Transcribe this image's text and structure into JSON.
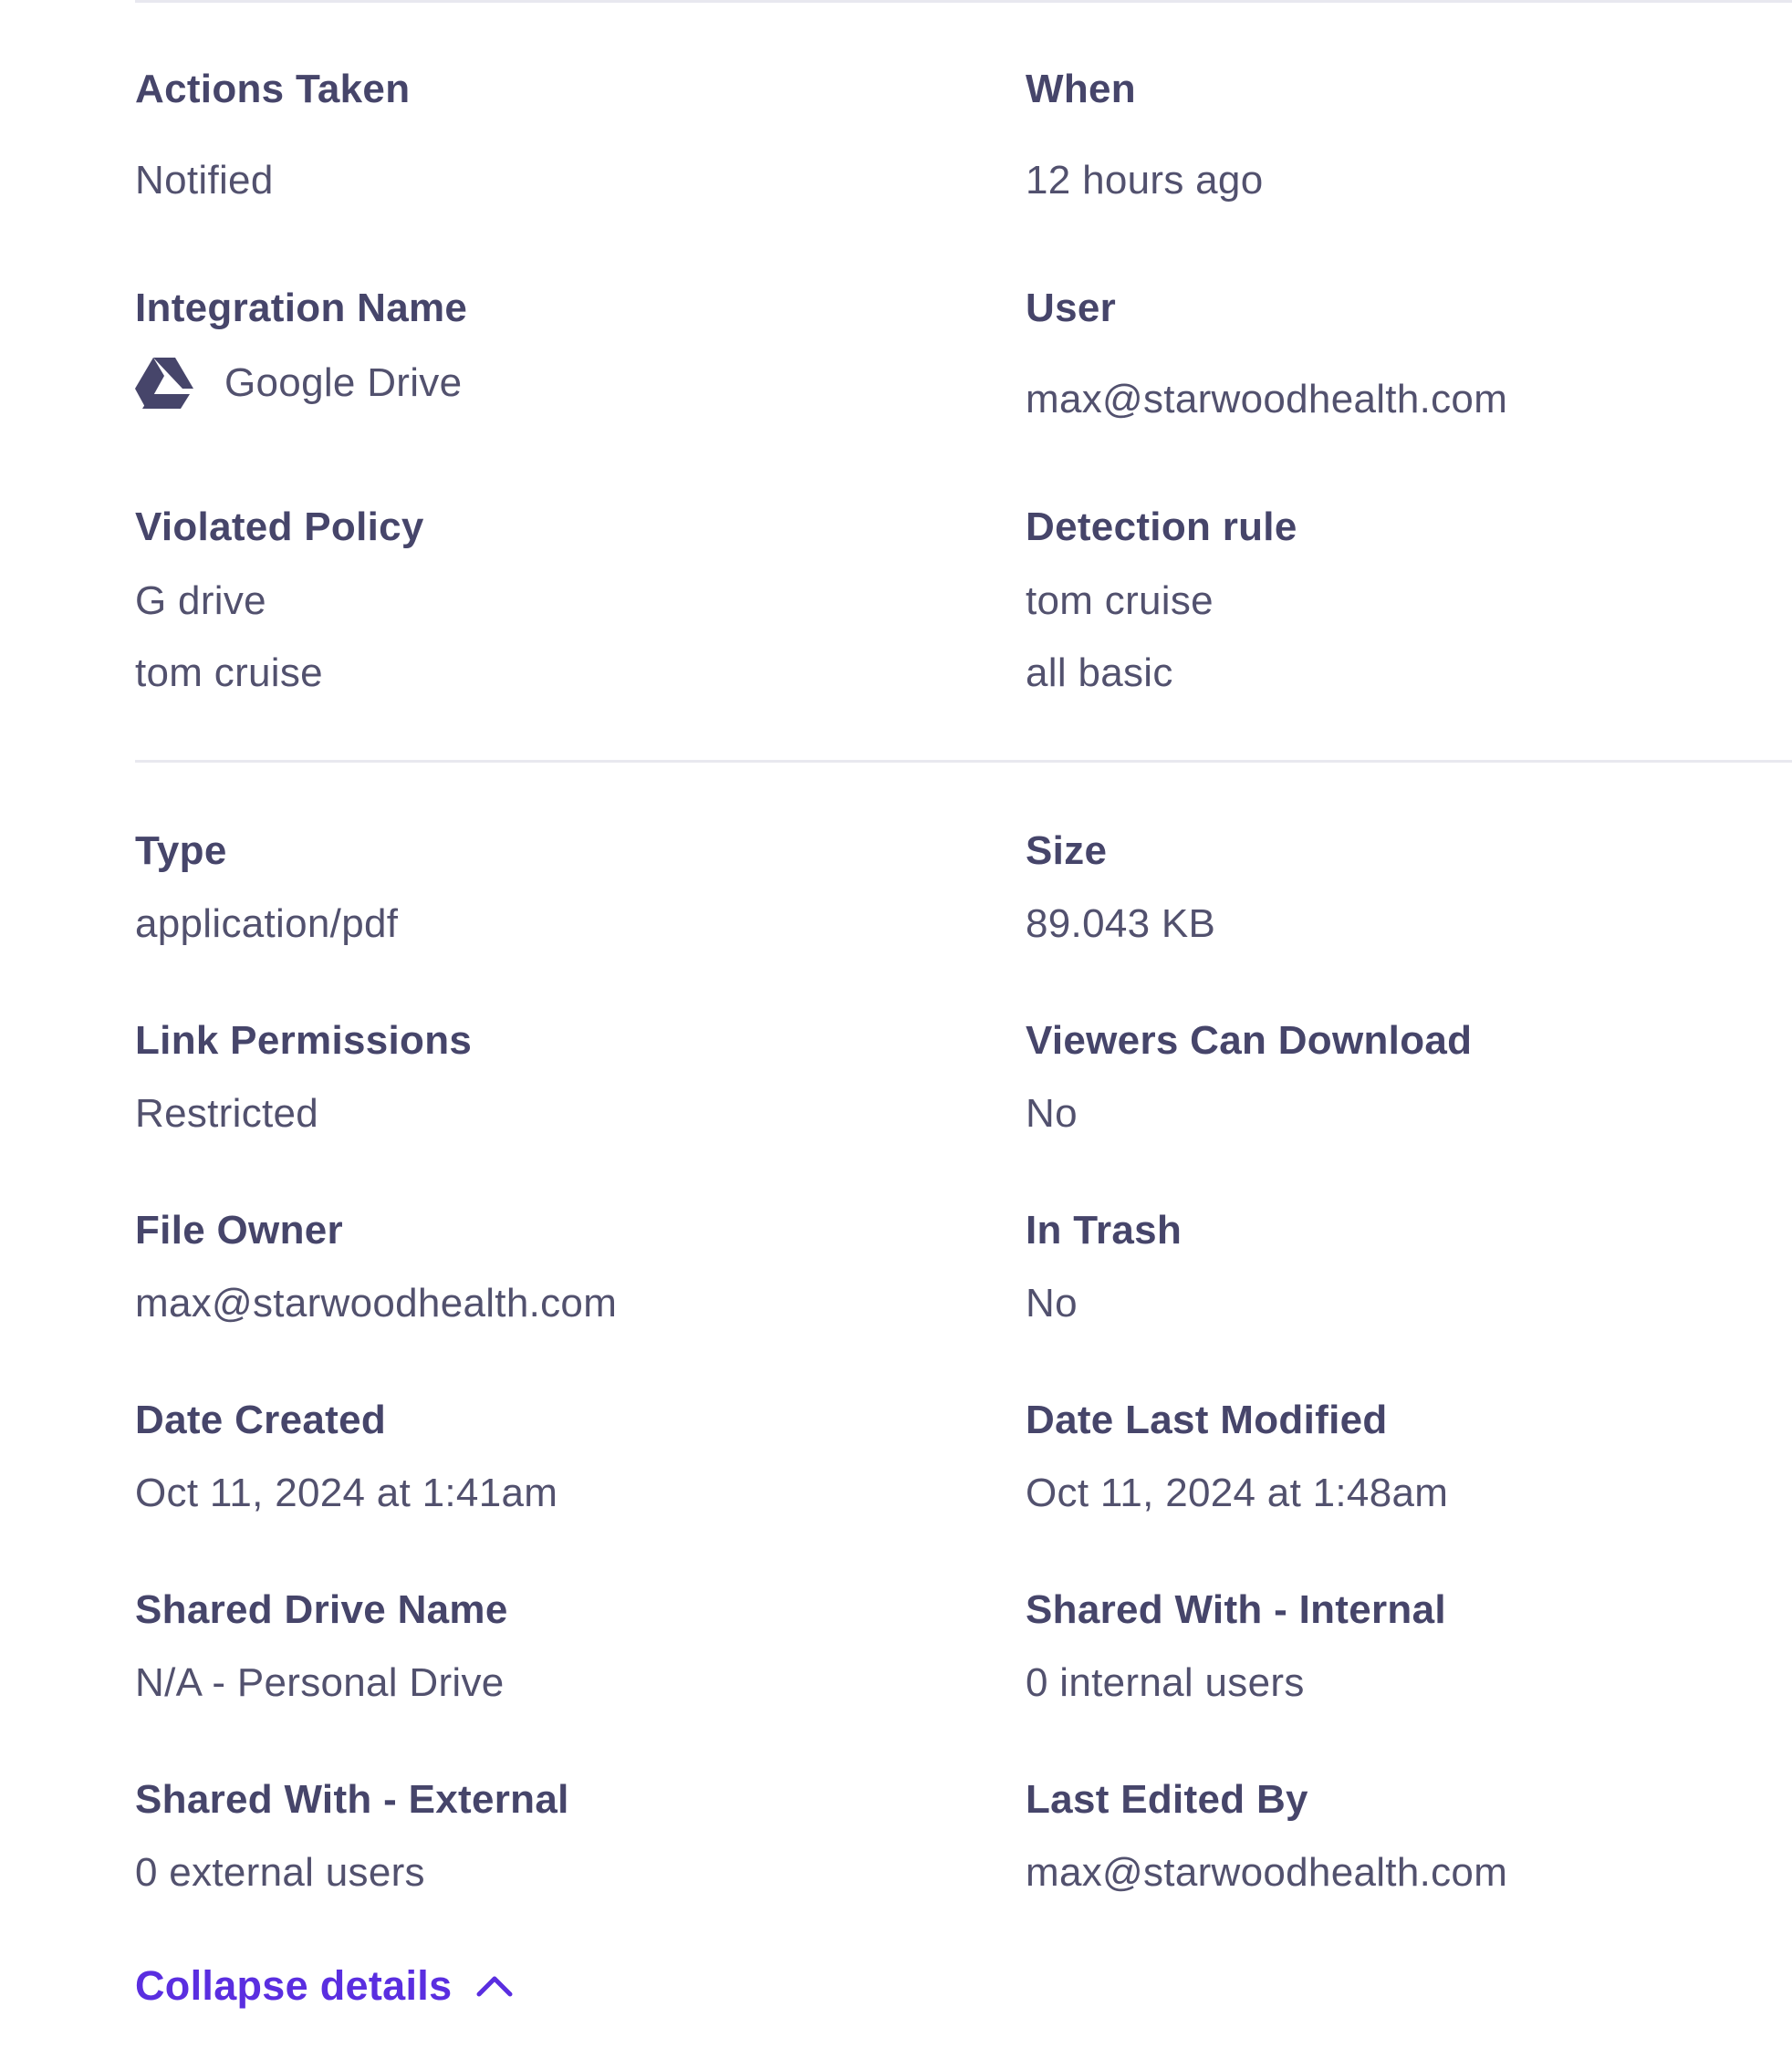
{
  "summary": {
    "actions_taken": {
      "label": "Actions Taken",
      "value": "Notified"
    },
    "when": {
      "label": "When",
      "value": "12 hours ago"
    },
    "integration_name": {
      "label": "Integration Name",
      "value": "Google Drive",
      "icon": "google-drive-icon"
    },
    "user": {
      "label": "User",
      "value": "max@starwoodhealth.com"
    },
    "violated_policy": {
      "label": "Violated Policy",
      "values": [
        "G drive",
        "tom cruise"
      ]
    },
    "detection_rule": {
      "label": "Detection rule",
      "values": [
        "tom cruise",
        "all basic"
      ]
    }
  },
  "details": {
    "type": {
      "label": "Type",
      "value": "application/pdf"
    },
    "size": {
      "label": "Size",
      "value": "89.043 KB"
    },
    "link_permissions": {
      "label": "Link Permissions",
      "value": "Restricted"
    },
    "viewers_can_download": {
      "label": "Viewers Can Download",
      "value": "No"
    },
    "file_owner": {
      "label": "File Owner",
      "value": "max@starwoodhealth.com"
    },
    "in_trash": {
      "label": "In Trash",
      "value": "No"
    },
    "date_created": {
      "label": "Date Created",
      "value": "Oct 11, 2024 at 1:41am"
    },
    "date_last_modified": {
      "label": "Date Last Modified",
      "value": "Oct 11, 2024 at 1:48am"
    },
    "shared_drive_name": {
      "label": "Shared Drive Name",
      "value": "N/A - Personal Drive"
    },
    "shared_with_internal": {
      "label": "Shared With - Internal",
      "value": "0 internal users"
    },
    "shared_with_external": {
      "label": "Shared With - External",
      "value": "0 external users"
    },
    "last_edited_by": {
      "label": "Last Edited By",
      "value": "max@starwoodhealth.com"
    }
  },
  "collapse": {
    "label": "Collapse details",
    "icon": "chevron-up-icon"
  },
  "colors": {
    "label": "#46456a",
    "value": "#52516e",
    "link": "#5a2ee0",
    "divider": "#e8e8ef"
  }
}
